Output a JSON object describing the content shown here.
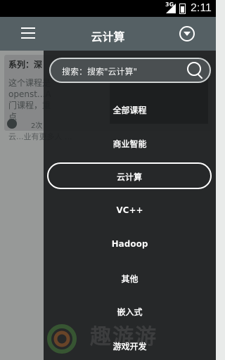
{
  "status_bar": {
    "network": "3G",
    "time": "2:11"
  },
  "app_bar": {
    "title": "云计算",
    "menu_icon": "menu-icon",
    "dropdown_icon": "dropdown-icon"
  },
  "background": {
    "series": "系列：深",
    "desc": "这个课程是openst...A门课程，重点",
    "count": "2次",
    "line": "云...业有更多人 ..."
  },
  "search": {
    "placeholder": "搜索：搜索\"云计算\""
  },
  "menu": [
    {
      "label": "全部课程",
      "active": false
    },
    {
      "label": "商业智能",
      "active": false
    },
    {
      "label": "云计算",
      "active": true
    },
    {
      "label": "VC++",
      "active": false
    },
    {
      "label": "Hadoop",
      "active": false
    },
    {
      "label": "其他",
      "active": false
    },
    {
      "label": "嵌入式",
      "active": false
    },
    {
      "label": "游戏开发",
      "active": false
    }
  ],
  "watermark": {
    "text": "趣游游"
  }
}
